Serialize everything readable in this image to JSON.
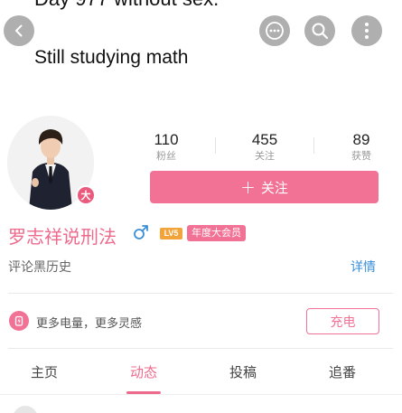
{
  "banner": {
    "line1": "Day 977 without sex.",
    "line2": "Still studying math"
  },
  "header_icons": [
    "back-icon",
    "more-icon",
    "search-icon",
    "menu-icon"
  ],
  "profile": {
    "avatar_badge": "大",
    "stats": {
      "fans": {
        "value": "110",
        "label": "粉丝"
      },
      "following": {
        "value": "455",
        "label": "关注"
      },
      "likes": {
        "value": "89",
        "label": "获赞"
      }
    },
    "follow_button": {
      "icon": "+",
      "label": "关注"
    },
    "name": "罗志祥说刑法",
    "gender": "male",
    "level_badge": "LV5",
    "vip_badge": "年度大会员",
    "bio": "评论黑历史",
    "details_link": "详情"
  },
  "charge": {
    "text": "更多电量，更多灵感",
    "button": "充电"
  },
  "tabs": [
    {
      "label": "主页",
      "active": false
    },
    {
      "label": "动态",
      "active": true
    },
    {
      "label": "投稿",
      "active": false
    },
    {
      "label": "追番",
      "active": false
    }
  ],
  "colors": {
    "accent_pink": "#f27296",
    "name_pink": "#ee6a8c",
    "link_blue": "#3a8fd8",
    "level_orange": "#f2a33a"
  }
}
